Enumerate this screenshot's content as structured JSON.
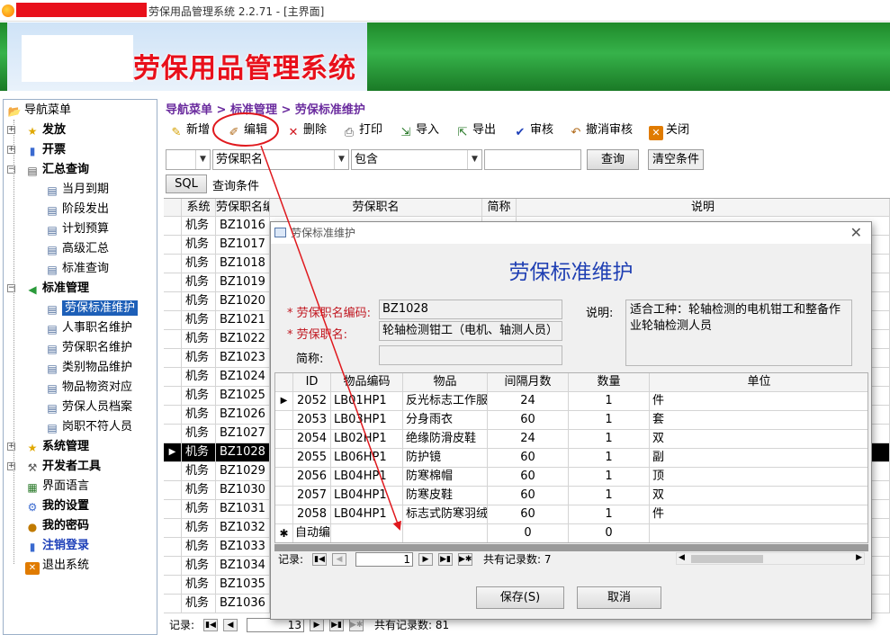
{
  "window": {
    "title": "劳保用品管理系统 2.2.71 - [主界面]"
  },
  "banner": {
    "app_name": "劳保用品管理系统"
  },
  "nav": {
    "root": "导航菜单",
    "groups": [
      {
        "label": "发放"
      },
      {
        "label": "开票"
      },
      {
        "label": "汇总查询",
        "items": [
          "当月到期",
          "阶段发出",
          "计划预算",
          "高级汇总",
          "标准查询"
        ]
      },
      {
        "label": "标准管理",
        "items": [
          "劳保标准维护",
          "人事职名维护",
          "劳保职名维护",
          "类别物品维护",
          "物品物资对应",
          "劳保人员档案",
          "岗职不符人员"
        ]
      },
      {
        "label": "系统管理"
      },
      {
        "label": "开发者工具"
      }
    ],
    "extra": [
      "界面语言",
      "我的设置",
      "我的密码",
      "注销登录",
      "退出系统"
    ]
  },
  "breadcrumb": "导航菜单 > 标准管理 > 劳保标准维护",
  "toolbar": {
    "add": "新增",
    "edit": "编辑",
    "delete": "删除",
    "print": "打印",
    "import": "导入",
    "export": "导出",
    "audit": "审核",
    "unaudit": "撤消审核",
    "close": "关闭"
  },
  "filter": {
    "field": "劳保职名",
    "op": "包含",
    "value": "",
    "query": "查询",
    "clear": "清空条件",
    "sql": "SQL",
    "cond_label": "查询条件"
  },
  "grid": {
    "columns": [
      "系统",
      "劳保职名编码",
      "劳保职名",
      "简称",
      "说明"
    ],
    "rows": [
      [
        "机务",
        "BZ1016"
      ],
      [
        "机务",
        "BZ1017"
      ],
      [
        "机务",
        "BZ1018"
      ],
      [
        "机务",
        "BZ1019"
      ],
      [
        "机务",
        "BZ1020"
      ],
      [
        "机务",
        "BZ1021"
      ],
      [
        "机务",
        "BZ1022"
      ],
      [
        "机务",
        "BZ1023"
      ],
      [
        "机务",
        "BZ1024"
      ],
      [
        "机务",
        "BZ1025"
      ],
      [
        "机务",
        "BZ1026"
      ],
      [
        "机务",
        "BZ1027"
      ],
      [
        "机务",
        "BZ1028"
      ],
      [
        "机务",
        "BZ1029"
      ],
      [
        "机务",
        "BZ1030"
      ],
      [
        "机务",
        "BZ1031"
      ],
      [
        "机务",
        "BZ1032"
      ],
      [
        "机务",
        "BZ1033"
      ],
      [
        "机务",
        "BZ1034"
      ],
      [
        "机务",
        "BZ1035"
      ],
      [
        "机务",
        "BZ1036"
      ]
    ],
    "active_index": 12,
    "footer_label": "记录:",
    "page": "13",
    "total": "共有记录数: 81"
  },
  "dialog": {
    "title": "劳保标准维护",
    "heading": "劳保标准维护",
    "code_label": "* 劳保职名编码:",
    "code_value": "BZ1028",
    "name_label": "* 劳保职名:",
    "name_value": "轮轴检测钳工（电机、轴测人员）",
    "short_label": "简称:",
    "short_value": "",
    "desc_label": "说明:",
    "desc_value": "适合工种：轮轴检测的电机钳工和整备作业轮轴检测人员",
    "columns": [
      "ID",
      "物品编码",
      "物品",
      "间隔月数",
      "数量",
      "单位"
    ],
    "rows": [
      [
        "2052",
        "LB01HP1",
        "反光标志工作服",
        "24",
        "1",
        "件"
      ],
      [
        "2053",
        "LB03HP1",
        "分身雨衣",
        "60",
        "1",
        "套"
      ],
      [
        "2054",
        "LB02HP1",
        "绝缘防滑皮鞋",
        "24",
        "1",
        "双"
      ],
      [
        "2055",
        "LB06HP1",
        "防护镜",
        "60",
        "1",
        "副"
      ],
      [
        "2056",
        "LB04HP1",
        "防寒棉帽",
        "60",
        "1",
        "顶"
      ],
      [
        "2057",
        "LB04HP1",
        "防寒皮鞋",
        "60",
        "1",
        "双"
      ],
      [
        "2058",
        "LB04HP1",
        "标志式防寒羽绒",
        "60",
        "1",
        "件"
      ]
    ],
    "new_row": [
      "自动编号",
      "",
      "",
      "0",
      "0",
      ""
    ],
    "footer_label": "记录:",
    "page": "1",
    "total": "共有记录数: 7",
    "save": "保存(S)",
    "cancel": "取消"
  },
  "colors": {
    "banner_green": "#2aa03c",
    "brand_red": "#e8101b",
    "crumb_purple": "#6a2b9e",
    "select_blue": "#1d5fb8",
    "annotation_red": "#e0191e"
  }
}
